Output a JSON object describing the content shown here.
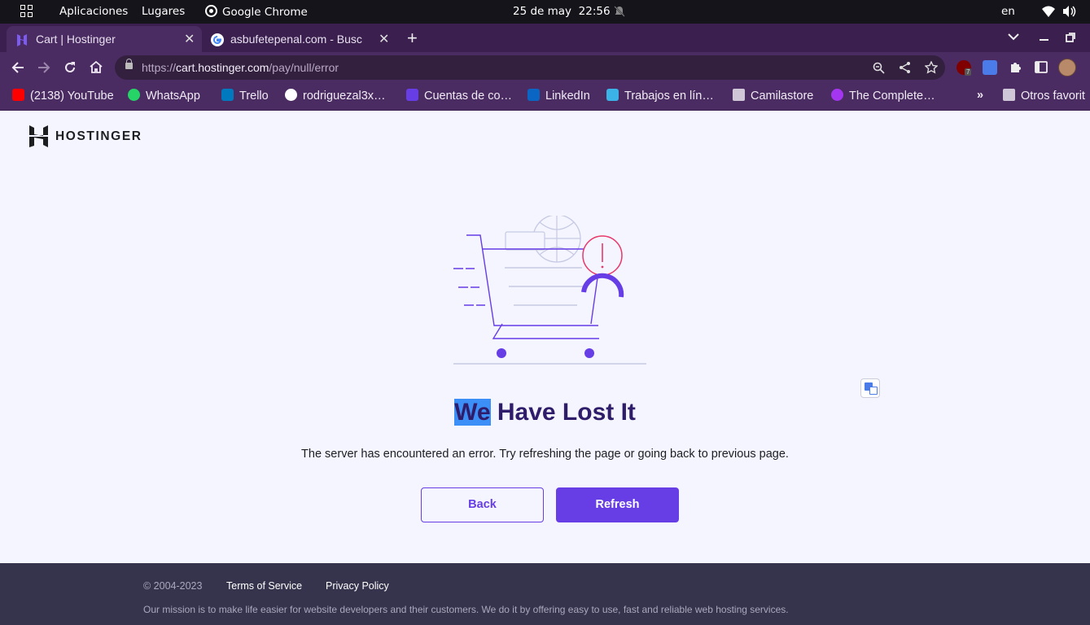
{
  "system_bar": {
    "apps_label": "Aplicaciones",
    "places_label": "Lugares",
    "active_app": "Google Chrome",
    "date": "25 de may",
    "time": "22:56",
    "language": "en"
  },
  "tabs": [
    {
      "title": "Cart | Hostinger",
      "active": true
    },
    {
      "title": "asbufetepenal.com - Busc",
      "active": false
    }
  ],
  "address_bar": {
    "scheme": "https://",
    "host": "cart.hostinger.com",
    "path": "/pay/null/error"
  },
  "extensions": {
    "ublock_badge": "7"
  },
  "bookmarks": [
    {
      "label": "(2138) YouTube",
      "icon": "youtube-icon"
    },
    {
      "label": "WhatsApp",
      "icon": "whatsapp-icon"
    },
    {
      "label": "Trello",
      "icon": "trello-icon"
    },
    {
      "label": "rodriguezal3x…",
      "icon": "github-icon"
    },
    {
      "label": "Cuentas de co…",
      "icon": "hostinger-icon"
    },
    {
      "label": "LinkedIn",
      "icon": "linkedin-icon"
    },
    {
      "label": "Trabajos en lín…",
      "icon": "workana-icon"
    },
    {
      "label": "Camilastore",
      "icon": "folder-icon"
    },
    {
      "label": "The Complete…",
      "icon": "udemy-icon"
    }
  ],
  "bookmarks_more": "»",
  "other_bookmarks": "Otros favorit",
  "page": {
    "brand": "HOSTINGER",
    "headline_selected": "We",
    "headline_rest": " Have Lost It",
    "message": "The server has encountered an error. Try refreshing the page or going back to previous page.",
    "back_label": "Back",
    "refresh_label": "Refresh"
  },
  "footer": {
    "copyright": "© 2004-2023",
    "terms": "Terms of Service",
    "privacy": "Privacy Policy",
    "mission": "Our mission is to make life easier for website developers and their customers. We do it by offering easy to use, fast and reliable web hosting services."
  },
  "colors": {
    "primary": "#673de6",
    "headline": "#2f1c6a",
    "footer_bg": "#36344d",
    "tabstrip_bg": "#3a1f4f",
    "toolbar_bg": "#4a2c62"
  }
}
